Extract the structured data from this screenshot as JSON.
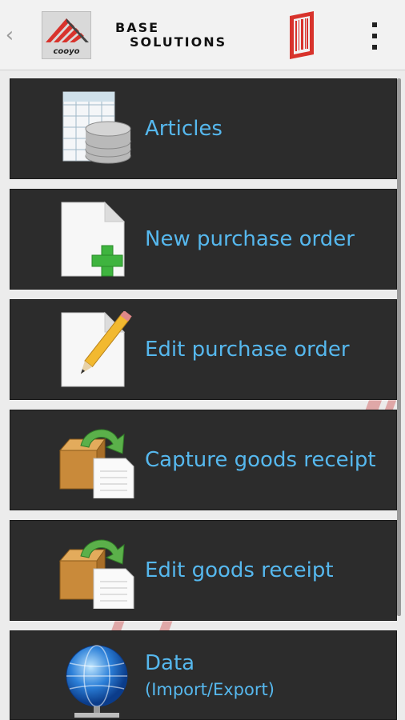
{
  "header": {
    "back_icon": "chevron-left-icon",
    "logo_text": "cooyo",
    "brand_line1": "BASE",
    "brand_line2": "SOLUTIONS",
    "barcode_icon": "barcode-icon",
    "overflow_icon": "overflow-menu-icon",
    "accent_color": "#d8332c"
  },
  "menu": {
    "label_color": "#56b8ee",
    "items": [
      {
        "label": "Articles",
        "icon": "database-table-icon"
      },
      {
        "label": "New purchase order",
        "icon": "new-document-icon"
      },
      {
        "label": "Edit purchase order",
        "icon": "edit-document-icon"
      },
      {
        "label": "Capture goods receipt",
        "icon": "box-document-icon"
      },
      {
        "label": "Edit goods receipt",
        "icon": "box-document-icon"
      },
      {
        "label": "Data",
        "sublabel": "(Import/Export)",
        "icon": "globe-network-icon"
      }
    ]
  }
}
